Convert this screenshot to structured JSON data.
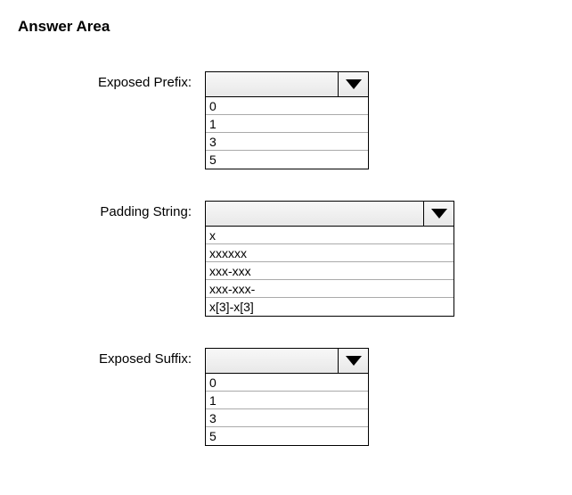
{
  "title": "Answer Area",
  "fields": {
    "exposed_prefix": {
      "label": "Exposed Prefix:",
      "selected": "",
      "options": [
        "0",
        "1",
        "3",
        "5"
      ]
    },
    "padding_string": {
      "label": "Padding String:",
      "selected": "",
      "options": [
        "x",
        "xxxxxx",
        "xxx-xxx",
        "xxx-xxx-",
        "x[3]-x[3]"
      ]
    },
    "exposed_suffix": {
      "label": "Exposed Suffix:",
      "selected": "",
      "options": [
        "0",
        "1",
        "3",
        "5"
      ]
    }
  }
}
